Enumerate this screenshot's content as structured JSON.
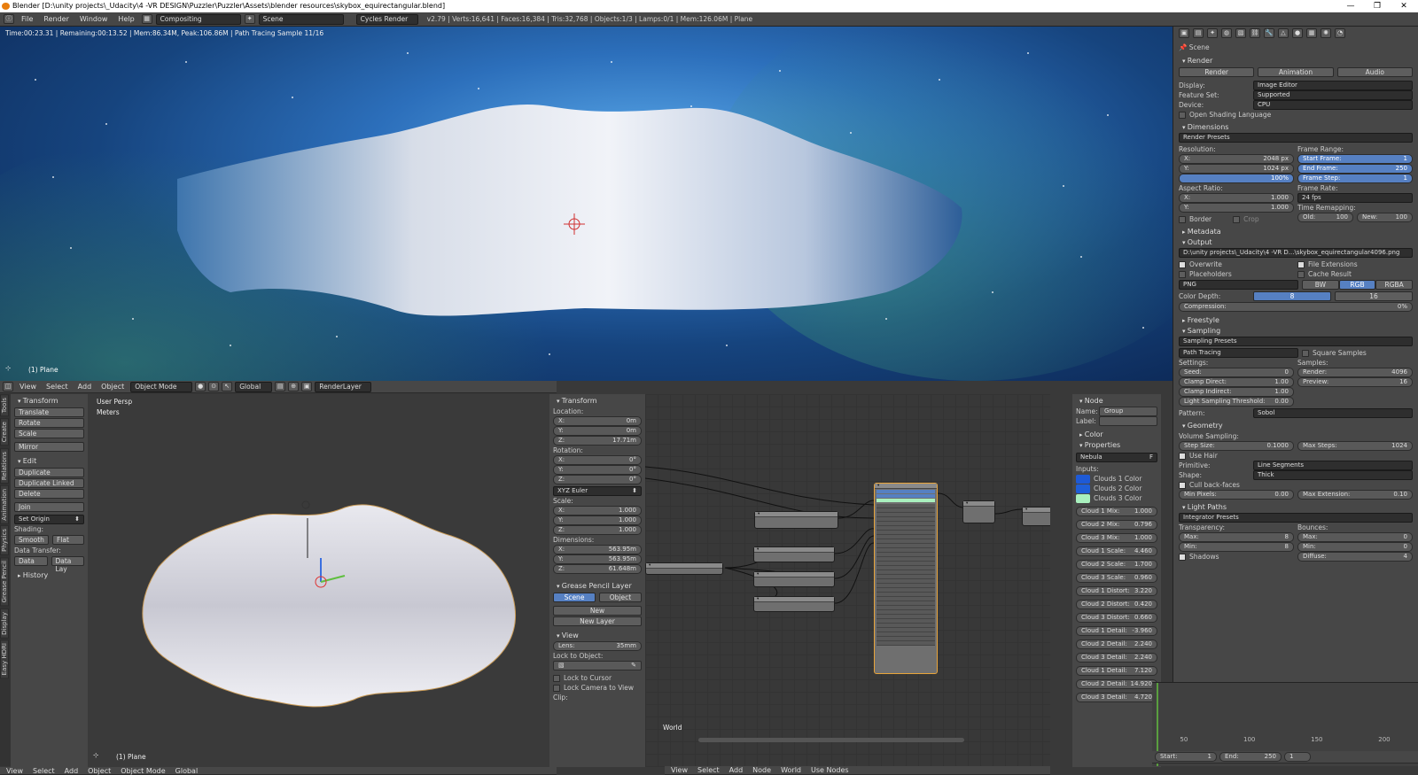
{
  "window": {
    "title": "Blender [D:\\unity projects\\_Udacity\\4 -VR DESIGN\\Puzzler\\Puzzler\\Assets\\blender resources\\skybox_equirectangular.blend]",
    "minimize": "—",
    "maximize": "❐",
    "close": "✕"
  },
  "topbar": {
    "menus": [
      "File",
      "Render",
      "Window",
      "Help"
    ],
    "layout": "Compositing",
    "scene": "Scene",
    "engine": "Cycles Render",
    "stats": "v2.79 | Verts:16,641 | Faces:16,384 | Tris:32,768 | Objects:1/3 | Lamps:0/1 | Mem:126.06M | Plane"
  },
  "viewport_top": {
    "render_status": "Time:00:23.31 | Remaining:00:13.52 | Mem:86.34M, Peak:106.86M | Path Tracing Sample 11/16",
    "object_label": "(1) Plane"
  },
  "viewport_header": {
    "menus": [
      "View",
      "Select",
      "Add",
      "Object"
    ],
    "mode": "Object Mode",
    "orientation": "Global",
    "render_layer": "RenderLayer"
  },
  "tool_shelf": {
    "tabs": [
      "Tools",
      "Create",
      "Relations",
      "Animation",
      "Physics",
      "Grease Pencil",
      "Display",
      "Easy HDRI"
    ],
    "transform_title": "Transform",
    "transform_buttons": [
      "Translate",
      "Rotate",
      "Scale",
      "Mirror"
    ],
    "edit_title": "Edit",
    "edit_buttons": [
      "Duplicate",
      "Duplicate Linked",
      "Delete",
      "Join"
    ],
    "set_origin": "Set Origin",
    "shading_label": "Shading:",
    "smooth": "Smooth",
    "flat": "Flat",
    "data_transfer_label": "Data Transfer:",
    "data": "Data",
    "data_lay": "Data Lay",
    "history": "History"
  },
  "viewport3d": {
    "persp": "User Persp",
    "units": "Meters",
    "object_label": "(1) Plane"
  },
  "n_panel": {
    "transform_title": "Transform",
    "location_label": "Location:",
    "location": [
      {
        "axis": "X:",
        "value": "0m"
      },
      {
        "axis": "Y:",
        "value": "0m"
      },
      {
        "axis": "Z:",
        "value": "17.71m"
      }
    ],
    "rotation_label": "Rotation:",
    "rotation": [
      {
        "axis": "X:",
        "value": "0°"
      },
      {
        "axis": "Y:",
        "value": "0°"
      },
      {
        "axis": "Z:",
        "value": "0°"
      }
    ],
    "rotation_mode": "XYZ Euler",
    "scale_label": "Scale:",
    "scale": [
      {
        "axis": "X:",
        "value": "1.000"
      },
      {
        "axis": "Y:",
        "value": "1.000"
      },
      {
        "axis": "Z:",
        "value": "1.000"
      }
    ],
    "dimensions_label": "Dimensions:",
    "dimensions": [
      {
        "axis": "X:",
        "value": "563.95m"
      },
      {
        "axis": "Y:",
        "value": "563.95m"
      },
      {
        "axis": "Z:",
        "value": "61.648m"
      }
    ],
    "grease_title": "Grease Pencil Layer",
    "scene_tab": "Scene",
    "object_tab": "Object",
    "new": "New",
    "new_layer": "New Layer",
    "view_title": "View",
    "lens_label": "Lens:",
    "lens": "35mm",
    "lock_label": "Lock to Object:",
    "lock_cursor": "Lock to Cursor",
    "lock_camera": "Lock Camera to View",
    "clip": "Clip:"
  },
  "node_editor": {
    "world_label": "World",
    "menus": [
      "View",
      "Select",
      "Add",
      "Node"
    ],
    "world_name": "World",
    "use_nodes": "Use Nodes"
  },
  "node_panel": {
    "node_title": "Node",
    "name_label": "Name:",
    "name": "Group",
    "label_label": "Label:",
    "color_title": "Color",
    "properties_title": "Properties",
    "group_name": "Nebula",
    "inputs_label": "Inputs:",
    "color_inputs": [
      {
        "name": "Clouds 1 Color",
        "color": "#1e5ad6"
      },
      {
        "name": "Clouds 2 Color",
        "color": "#1f5fd8"
      },
      {
        "name": "Clouds 3 Color",
        "color": "#a9f0be"
      }
    ],
    "values": [
      {
        "name": "Cloud 1 Mix:",
        "value": "1.000"
      },
      {
        "name": "Cloud 2 Mix:",
        "value": "0.796"
      },
      {
        "name": "Cloud 3 Mix:",
        "value": "1.000"
      },
      {
        "name": "Cloud 1 Scale:",
        "value": "4.460"
      },
      {
        "name": "Cloud 2 Scale:",
        "value": "1.700"
      },
      {
        "name": "Cloud 3 Scale:",
        "value": "0.960"
      },
      {
        "name": "Cloud 1 Distort:",
        "value": "3.220"
      },
      {
        "name": "Cloud 2 Distort:",
        "value": "0.420"
      },
      {
        "name": "Cloud 3 Distort:",
        "value": "0.660"
      },
      {
        "name": "Cloud 1 Detail:",
        "value": "-3.960"
      },
      {
        "name": "Cloud 2 Detail:",
        "value": "2.240"
      },
      {
        "name": "Cloud 3 Detail:",
        "value": "2.240"
      },
      {
        "name": "Cloud 1 Detail:",
        "value": "7.120"
      },
      {
        "name": "Cloud 2 Detail:",
        "value": "14.920"
      },
      {
        "name": "Cloud 3 Detail:",
        "value": "4.720"
      }
    ]
  },
  "properties": {
    "scene_label": "Scene",
    "render_title": "Render",
    "render_btn": "Render",
    "animation_btn": "Animation",
    "audio_btn": "Audio",
    "display_label": "Display:",
    "display": "Image Editor",
    "feature_label": "Feature Set:",
    "feature": "Supported",
    "device_label": "Device:",
    "device": "CPU",
    "osl": "Open Shading Language",
    "dimensions_title": "Dimensions",
    "render_presets": "Render Presets",
    "resolution_label": "Resolution:",
    "res_x": "2048 px",
    "res_y": "1024 px",
    "res_pct": "100%",
    "frame_range_label": "Frame Range:",
    "start_frame": "1",
    "end_frame": "250",
    "frame_step": "1",
    "aspect_label": "Aspect Ratio:",
    "aspect_x": "1.000",
    "aspect_y": "1.000",
    "frame_rate_label": "Frame Rate:",
    "frame_rate": "24 fps",
    "time_remap_label": "Time Remapping:",
    "old": "100",
    "new": "100",
    "border": "Border",
    "crop": "Crop",
    "metadata_title": "Metadata",
    "output_title": "Output",
    "output_path": "D:\\unity projects\\_Udacity\\4 -VR D...\\skybox_equirectangular4096.png",
    "overwrite": "Overwrite",
    "file_ext": "File Extensions",
    "placeholders": "Placeholders",
    "cache": "Cache Result",
    "format": "PNG",
    "bw": "BW",
    "rgb": "RGB",
    "rgba": "RGBA",
    "color_depth_label": "Color Depth:",
    "depth8": "8",
    "depth16": "16",
    "compression_label": "Compression:",
    "compression": "0%",
    "freestyle_title": "Freestyle",
    "sampling_title": "Sampling",
    "sampling_presets": "Sampling Presets",
    "path_tracing": "Path Tracing",
    "square_samples": "Square Samples",
    "settings_label": "Settings:",
    "samples_label": "Samples:",
    "seed": "0",
    "render_samples": "4096",
    "clamp_direct": "1.00",
    "preview_samples": "16",
    "clamp_indirect": "1.00",
    "light_threshold": "0.00",
    "pattern_label": "Pattern:",
    "pattern": "Sobol",
    "geometry_title": "Geometry",
    "volume_label": "Volume Sampling:",
    "step_size": "0.1000",
    "max_steps": "1024",
    "use_hair": "Use Hair",
    "primitive_label": "Primitive:",
    "primitive": "Line Segments",
    "shape_label": "Shape:",
    "shape": "Thick",
    "cull": "Cull back-faces",
    "min_pixels": "0.00",
    "max_ext": "0.10",
    "light_paths_title": "Light Paths",
    "integrator_presets": "Integrator Presets",
    "transparency_label": "Transparency:",
    "bounces_label": "Bounces:",
    "t_max": "8",
    "t_min": "8",
    "b_max": "0",
    "b_min": "0",
    "shadows": "Shadows",
    "diffuse": "4"
  },
  "timeline": {
    "ticks": [
      "50",
      "100",
      "150",
      "200"
    ],
    "start_label": "Start:",
    "start": "1",
    "end_label": "End:",
    "end": "250",
    "current": "1"
  }
}
